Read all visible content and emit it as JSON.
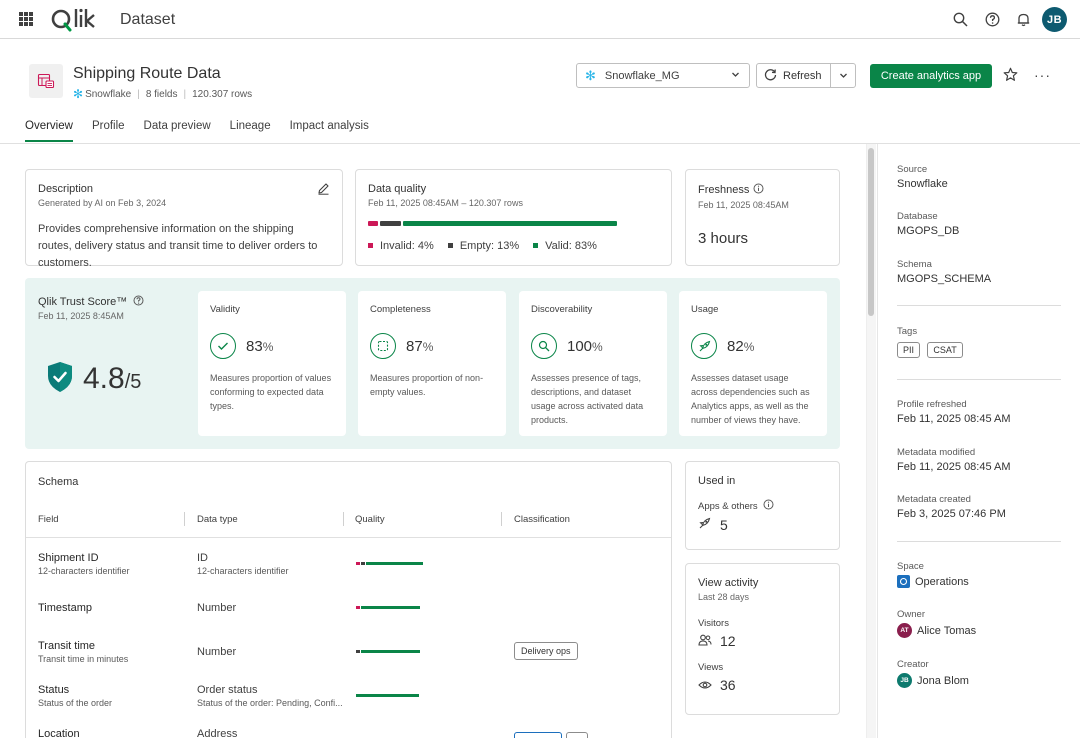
{
  "app": {
    "logo_text": "Qlik",
    "title": "Dataset",
    "user_initials": "JB"
  },
  "icons": {
    "waffle": "waffle-icon",
    "search": "search-icon",
    "help": "help-icon",
    "bell": "bell-icon"
  },
  "dataset": {
    "name": "Shipping Route Data",
    "source": "Snowflake",
    "fields": "8 fields",
    "rows": "120.307 rows"
  },
  "toolbar": {
    "connection": "Snowflake_MG",
    "refresh_label": "Refresh",
    "create_label": "Create analytics app"
  },
  "tabs": [
    {
      "label": "Overview",
      "active": true
    },
    {
      "label": "Profile"
    },
    {
      "label": "Data preview"
    },
    {
      "label": "Lineage"
    },
    {
      "label": "Impact analysis"
    }
  ],
  "description": {
    "title": "Description",
    "sub": "Generated by AI on Feb 3, 2024",
    "body": "Provides comprehensive information on the shipping routes, delivery status and transit time to deliver orders to customers."
  },
  "data_quality": {
    "title": "Data quality",
    "sub": "Feb 11, 2025 08:45AM – 120.307 rows",
    "invalid_label": "Invalid: 4%",
    "empty_label": "Empty: 13%",
    "valid_label": "Valid: 83%",
    "invalid": 4,
    "empty": 13,
    "valid": 83,
    "colors": {
      "invalid": "#cc1857",
      "empty": "#404040",
      "valid": "#0a8548"
    }
  },
  "freshness": {
    "title": "Freshness",
    "sub": "Feb 11, 2025 08:45AM",
    "value": "3 hours"
  },
  "trust": {
    "title": "Qlik Trust Score™",
    "sub": "Feb 11, 2025 8:45AM",
    "score": "4.8",
    "max": "/5",
    "metrics": [
      {
        "name": "Validity",
        "value": "83",
        "unit": "%",
        "desc": "Measures proportion of values conforming to expected data types.",
        "icon": "check-icon"
      },
      {
        "name": "Completeness",
        "value": "87",
        "unit": "%",
        "desc": "Measures proportion of non-empty values.",
        "icon": "dashed-square-icon"
      },
      {
        "name": "Discoverability",
        "value": "100",
        "unit": "%",
        "desc": "Assesses presence of tags, descriptions, and dataset usage across activated data products.",
        "icon": "magnifier-icon"
      },
      {
        "name": "Usage",
        "value": "82",
        "unit": "%",
        "desc": "Assesses dataset usage across dependencies such as Analytics apps, as well as the number of views they have.",
        "icon": "rocket-icon"
      }
    ]
  },
  "schema": {
    "title": "Schema",
    "headers": {
      "field": "Field",
      "type": "Data type",
      "quality": "Quality",
      "classification": "Classification"
    },
    "rows": [
      {
        "field": "Shipment ID",
        "field_sub": "12-characters identifier",
        "type": "ID",
        "type_sub": "12-characters identifier",
        "q": [
          7,
          3,
          90
        ],
        "tag": ""
      },
      {
        "field": "Timestamp",
        "field_sub": "",
        "type": "Number",
        "type_sub": "",
        "q": [
          7,
          0,
          93
        ],
        "tag": ""
      },
      {
        "field": "Transit time",
        "field_sub": "Transit time in minutes",
        "type": "Number",
        "type_sub": "",
        "q": [
          0,
          7,
          93
        ],
        "tag": "Delivery ops"
      },
      {
        "field": "Status",
        "field_sub": "Status of the order",
        "type": "Order status",
        "type_sub": "Status of the order: Pending, Confi...",
        "q": [
          0,
          0,
          100
        ],
        "tag": ""
      },
      {
        "field": "Location",
        "field_sub": "",
        "type": "Address",
        "type_sub": "",
        "q": [
          0,
          0,
          0
        ],
        "tag": ""
      }
    ]
  },
  "used_in": {
    "title": "Used in",
    "apps_label": "Apps & others",
    "apps_value": "5"
  },
  "view_activity": {
    "title": "View activity",
    "sub": "Last 28 days",
    "visitors_label": "Visitors",
    "visitors_value": "12",
    "views_label": "Views",
    "views_value": "36"
  },
  "panel": {
    "source_label": "Source",
    "source_value": "Snowflake",
    "database_label": "Database",
    "database_value": "MGOPS_DB",
    "schema_label": "Schema",
    "schema_value": "MGOPS_SCHEMA",
    "tags_label": "Tags",
    "tags": [
      "PII",
      "CSAT"
    ],
    "refreshed_label": "Profile refreshed",
    "refreshed_value": "Feb 11, 2025 08:45 AM",
    "modified_label": "Metadata modified",
    "modified_value": "Feb 11, 2025 08:45 AM",
    "created_label": "Metadata created",
    "created_value": "Feb 3, 2025 07:46 PM",
    "space_label": "Space",
    "space_value": "Operations",
    "owner_label": "Owner",
    "owner_initials": "AT",
    "owner_value": "Alice Tomas",
    "creator_label": "Creator",
    "creator_initials": "JB",
    "creator_value": "Jona Blom"
  }
}
